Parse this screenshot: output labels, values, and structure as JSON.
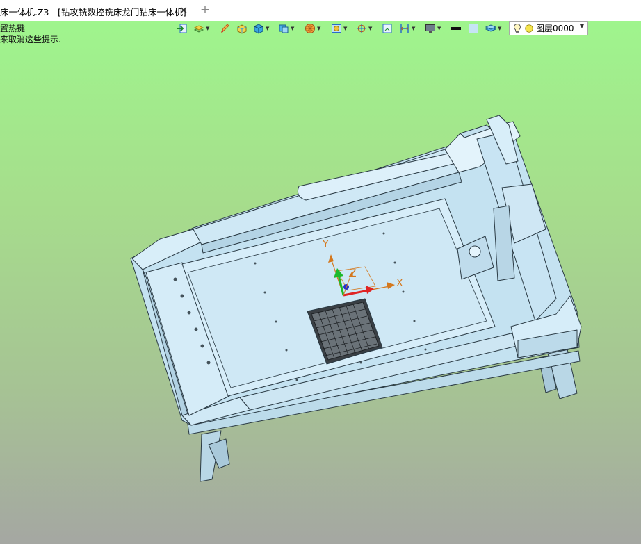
{
  "tab": {
    "title": "床一体机.Z3 - [钻攻铣数控铣床龙门钻床一体机]",
    "close_symbol": "✕",
    "add_symbol": "+"
  },
  "hints": {
    "line1": "置热键",
    "line2": "来取消这些提示."
  },
  "toolbar": {
    "layer_value": "图层0000",
    "icons": [
      "exit-icon",
      "layer-tools-icon",
      "pen-icon",
      "box-yellow-icon",
      "cube-icon",
      "view-cube-icon",
      "sphere-icon",
      "render-icon",
      "origin-icon",
      "frame-icon",
      "dimension-icon",
      "monitor-icon",
      "line-color-icon",
      "fill-color-icon",
      "layers-icon",
      "bulb-icon",
      "sun-icon"
    ]
  },
  "axes": {
    "x": "X",
    "y": "Y",
    "z": "Z"
  },
  "colors": {
    "bg_top": "#9ff58d",
    "bg_bottom": "#a5a7a2",
    "model_fill": "#cfe9f5",
    "model_edge": "#2a3a44",
    "axis_orange": "#d4781e"
  }
}
